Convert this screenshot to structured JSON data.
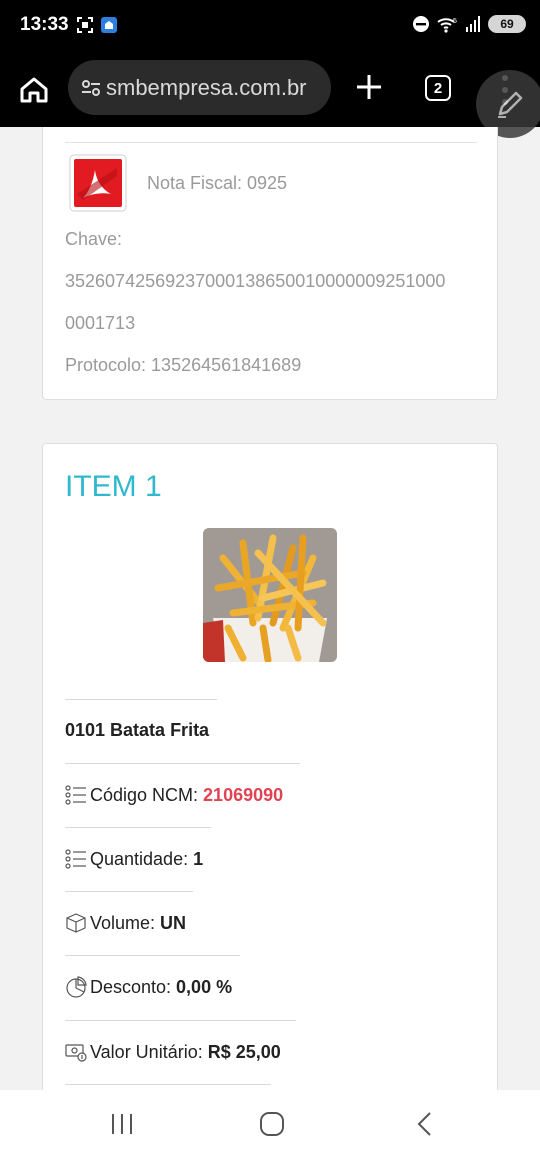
{
  "status": {
    "time": "13:33",
    "battery": "69"
  },
  "browser": {
    "url": "smbempresa.com.br",
    "tab_count": "2",
    "icons": [
      "home-icon",
      "site-settings-icon",
      "plus-icon",
      "tabs-icon",
      "more-vert-icon",
      "edit-icon"
    ]
  },
  "invoice": {
    "nota_fiscal": "Nota Fiscal: 0925",
    "chave_label": "Chave:",
    "chave_line1": "35260742569237000138650010000009251000",
    "chave_line2": "0001713",
    "protocolo": "Protocolo: 135264561841689"
  },
  "item": {
    "title": "ITEM 1",
    "name": "0101 Batata Frita",
    "ncm_label": "Código NCM:",
    "ncm_value": "21069090",
    "quantidade_label": "Quantidade:",
    "quantidade_value": "1",
    "volume_label": "Volume:",
    "volume_value": "UN",
    "desconto_label": "Desconto:",
    "desconto_value": "0,00 %",
    "valor_label": "Valor Unitário:",
    "valor_value": "R$ 25,00"
  },
  "colors": {
    "accent": "#2fb8cf",
    "ncm_red": "#e04452"
  }
}
